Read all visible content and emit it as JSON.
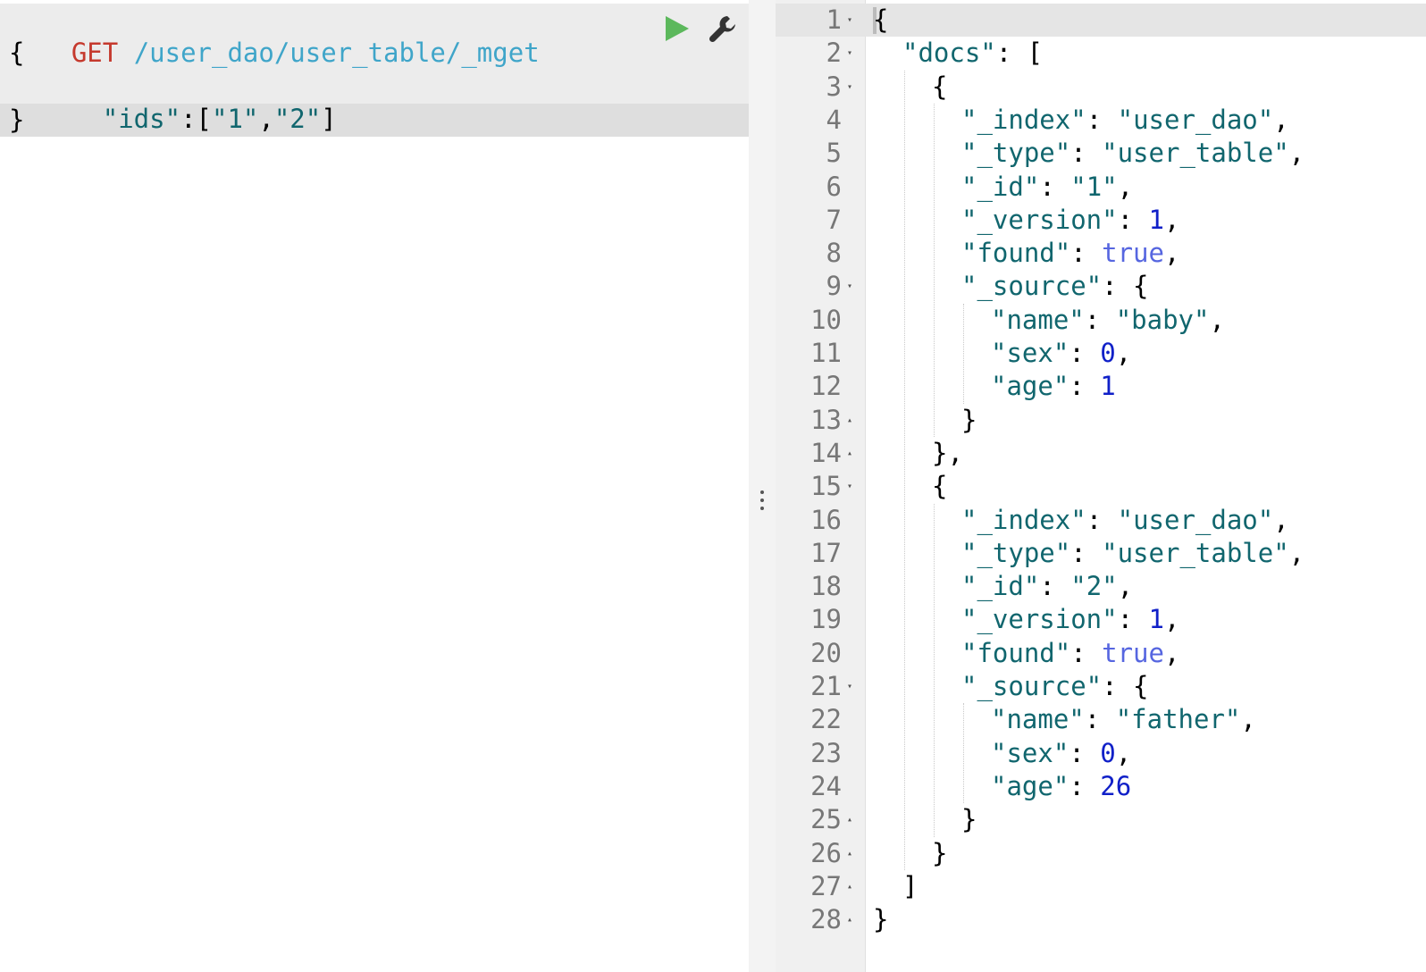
{
  "request": {
    "method": "GET",
    "url": "/user_dao/user_table/_mget",
    "body_lines": [
      "{",
      "  \"ids\":[\"1\",\"2\"]",
      "}"
    ],
    "run_icon": "play-icon",
    "settings_icon": "wrench-icon"
  },
  "response": {
    "lines": [
      {
        "n": "1",
        "fold": "▾",
        "indent": 0,
        "tokens": [
          {
            "t": "{",
            "c": "punc"
          }
        ]
      },
      {
        "n": "2",
        "fold": "▾",
        "indent": 1,
        "tokens": [
          {
            "t": "\"docs\"",
            "c": "key"
          },
          {
            "t": ": [",
            "c": "punc"
          }
        ]
      },
      {
        "n": "3",
        "fold": "▾",
        "indent": 2,
        "tokens": [
          {
            "t": "{",
            "c": "punc"
          }
        ]
      },
      {
        "n": "4",
        "fold": "",
        "indent": 3,
        "tokens": [
          {
            "t": "\"_index\"",
            "c": "key"
          },
          {
            "t": ": ",
            "c": "punc"
          },
          {
            "t": "\"user_dao\"",
            "c": "str"
          },
          {
            "t": ",",
            "c": "punc"
          }
        ]
      },
      {
        "n": "5",
        "fold": "",
        "indent": 3,
        "tokens": [
          {
            "t": "\"_type\"",
            "c": "key"
          },
          {
            "t": ": ",
            "c": "punc"
          },
          {
            "t": "\"user_table\"",
            "c": "str"
          },
          {
            "t": ",",
            "c": "punc"
          }
        ]
      },
      {
        "n": "6",
        "fold": "",
        "indent": 3,
        "tokens": [
          {
            "t": "\"_id\"",
            "c": "key"
          },
          {
            "t": ": ",
            "c": "punc"
          },
          {
            "t": "\"1\"",
            "c": "str"
          },
          {
            "t": ",",
            "c": "punc"
          }
        ]
      },
      {
        "n": "7",
        "fold": "",
        "indent": 3,
        "tokens": [
          {
            "t": "\"_version\"",
            "c": "key"
          },
          {
            "t": ": ",
            "c": "punc"
          },
          {
            "t": "1",
            "c": "num"
          },
          {
            "t": ",",
            "c": "punc"
          }
        ]
      },
      {
        "n": "8",
        "fold": "",
        "indent": 3,
        "tokens": [
          {
            "t": "\"found\"",
            "c": "key"
          },
          {
            "t": ": ",
            "c": "punc"
          },
          {
            "t": "true",
            "c": "bool"
          },
          {
            "t": ",",
            "c": "punc"
          }
        ]
      },
      {
        "n": "9",
        "fold": "▾",
        "indent": 3,
        "tokens": [
          {
            "t": "\"_source\"",
            "c": "key"
          },
          {
            "t": ": {",
            "c": "punc"
          }
        ]
      },
      {
        "n": "10",
        "fold": "",
        "indent": 4,
        "tokens": [
          {
            "t": "\"name\"",
            "c": "key"
          },
          {
            "t": ": ",
            "c": "punc"
          },
          {
            "t": "\"baby\"",
            "c": "str"
          },
          {
            "t": ",",
            "c": "punc"
          }
        ]
      },
      {
        "n": "11",
        "fold": "",
        "indent": 4,
        "tokens": [
          {
            "t": "\"sex\"",
            "c": "key"
          },
          {
            "t": ": ",
            "c": "punc"
          },
          {
            "t": "0",
            "c": "num"
          },
          {
            "t": ",",
            "c": "punc"
          }
        ]
      },
      {
        "n": "12",
        "fold": "",
        "indent": 4,
        "tokens": [
          {
            "t": "\"age\"",
            "c": "key"
          },
          {
            "t": ": ",
            "c": "punc"
          },
          {
            "t": "1",
            "c": "num"
          }
        ]
      },
      {
        "n": "13",
        "fold": "▴",
        "indent": 3,
        "tokens": [
          {
            "t": "}",
            "c": "punc"
          }
        ]
      },
      {
        "n": "14",
        "fold": "▴",
        "indent": 2,
        "tokens": [
          {
            "t": "},",
            "c": "punc"
          }
        ]
      },
      {
        "n": "15",
        "fold": "▾",
        "indent": 2,
        "tokens": [
          {
            "t": "{",
            "c": "punc"
          }
        ]
      },
      {
        "n": "16",
        "fold": "",
        "indent": 3,
        "tokens": [
          {
            "t": "\"_index\"",
            "c": "key"
          },
          {
            "t": ": ",
            "c": "punc"
          },
          {
            "t": "\"user_dao\"",
            "c": "str"
          },
          {
            "t": ",",
            "c": "punc"
          }
        ]
      },
      {
        "n": "17",
        "fold": "",
        "indent": 3,
        "tokens": [
          {
            "t": "\"_type\"",
            "c": "key"
          },
          {
            "t": ": ",
            "c": "punc"
          },
          {
            "t": "\"user_table\"",
            "c": "str"
          },
          {
            "t": ",",
            "c": "punc"
          }
        ]
      },
      {
        "n": "18",
        "fold": "",
        "indent": 3,
        "tokens": [
          {
            "t": "\"_id\"",
            "c": "key"
          },
          {
            "t": ": ",
            "c": "punc"
          },
          {
            "t": "\"2\"",
            "c": "str"
          },
          {
            "t": ",",
            "c": "punc"
          }
        ]
      },
      {
        "n": "19",
        "fold": "",
        "indent": 3,
        "tokens": [
          {
            "t": "\"_version\"",
            "c": "key"
          },
          {
            "t": ": ",
            "c": "punc"
          },
          {
            "t": "1",
            "c": "num"
          },
          {
            "t": ",",
            "c": "punc"
          }
        ]
      },
      {
        "n": "20",
        "fold": "",
        "indent": 3,
        "tokens": [
          {
            "t": "\"found\"",
            "c": "key"
          },
          {
            "t": ": ",
            "c": "punc"
          },
          {
            "t": "true",
            "c": "bool"
          },
          {
            "t": ",",
            "c": "punc"
          }
        ]
      },
      {
        "n": "21",
        "fold": "▾",
        "indent": 3,
        "tokens": [
          {
            "t": "\"_source\"",
            "c": "key"
          },
          {
            "t": ": {",
            "c": "punc"
          }
        ]
      },
      {
        "n": "22",
        "fold": "",
        "indent": 4,
        "tokens": [
          {
            "t": "\"name\"",
            "c": "key"
          },
          {
            "t": ": ",
            "c": "punc"
          },
          {
            "t": "\"father\"",
            "c": "str"
          },
          {
            "t": ",",
            "c": "punc"
          }
        ]
      },
      {
        "n": "23",
        "fold": "",
        "indent": 4,
        "tokens": [
          {
            "t": "\"sex\"",
            "c": "key"
          },
          {
            "t": ": ",
            "c": "punc"
          },
          {
            "t": "0",
            "c": "num"
          },
          {
            "t": ",",
            "c": "punc"
          }
        ]
      },
      {
        "n": "24",
        "fold": "",
        "indent": 4,
        "tokens": [
          {
            "t": "\"age\"",
            "c": "key"
          },
          {
            "t": ": ",
            "c": "punc"
          },
          {
            "t": "26",
            "c": "num"
          }
        ]
      },
      {
        "n": "25",
        "fold": "▴",
        "indent": 3,
        "tokens": [
          {
            "t": "}",
            "c": "punc"
          }
        ]
      },
      {
        "n": "26",
        "fold": "▴",
        "indent": 2,
        "tokens": [
          {
            "t": "}",
            "c": "punc"
          }
        ]
      },
      {
        "n": "27",
        "fold": "▴",
        "indent": 1,
        "tokens": [
          {
            "t": "]",
            "c": "punc"
          }
        ]
      },
      {
        "n": "28",
        "fold": "▴",
        "indent": 0,
        "tokens": [
          {
            "t": "}",
            "c": "punc"
          }
        ]
      }
    ]
  }
}
